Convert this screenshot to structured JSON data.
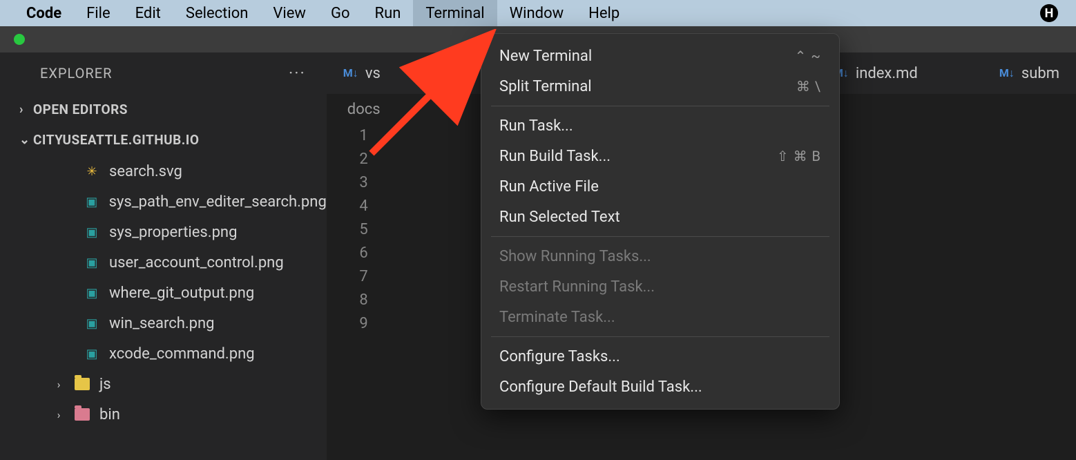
{
  "menubar": {
    "app": "Code",
    "items": [
      "File",
      "Edit",
      "Selection",
      "View",
      "Go",
      "Run",
      "Terminal",
      "Window",
      "Help"
    ],
    "active_index": 6,
    "status_icon_letter": "H"
  },
  "sidebar": {
    "title": "EXPLORER",
    "sections": {
      "open_editors": "OPEN EDITORS",
      "repo": "CITYUSEATTLE.GITHUB.IO"
    },
    "files": [
      {
        "name": "search.svg",
        "icon": "svg"
      },
      {
        "name": "sys_path_env_editer_search.png",
        "icon": "png"
      },
      {
        "name": "sys_properties.png",
        "icon": "png"
      },
      {
        "name": "user_account_control.png",
        "icon": "png"
      },
      {
        "name": "where_git_output.png",
        "icon": "png"
      },
      {
        "name": "win_search.png",
        "icon": "png"
      },
      {
        "name": "xcode_command.png",
        "icon": "png"
      }
    ],
    "folders": [
      {
        "name": "js",
        "color": "js"
      },
      {
        "name": "bin",
        "color": "bin"
      }
    ]
  },
  "tabs": {
    "left_partial": "vs",
    "index": "index.md",
    "subm": "subm"
  },
  "breadcrumb": "docs",
  "gutter_lines": [
    "1",
    "2",
    "3",
    "4",
    "5",
    "6",
    "7",
    "8",
    "9"
  ],
  "dropdown": {
    "groups": [
      [
        {
          "label": "New Terminal",
          "shortcut": "⌃ ~",
          "enabled": true
        },
        {
          "label": "Split Terminal",
          "shortcut": "⌘ \\",
          "enabled": true
        }
      ],
      [
        {
          "label": "Run Task...",
          "shortcut": "",
          "enabled": true
        },
        {
          "label": "Run Build Task...",
          "shortcut": "⇧ ⌘ B",
          "enabled": true
        },
        {
          "label": "Run Active File",
          "shortcut": "",
          "enabled": true
        },
        {
          "label": "Run Selected Text",
          "shortcut": "",
          "enabled": true
        }
      ],
      [
        {
          "label": "Show Running Tasks...",
          "shortcut": "",
          "enabled": false
        },
        {
          "label": "Restart Running Task...",
          "shortcut": "",
          "enabled": false
        },
        {
          "label": "Terminate Task...",
          "shortcut": "",
          "enabled": false
        }
      ],
      [
        {
          "label": "Configure Tasks...",
          "shortcut": "",
          "enabled": true
        },
        {
          "label": "Configure Default Build Task...",
          "shortcut": "",
          "enabled": true
        }
      ]
    ]
  }
}
